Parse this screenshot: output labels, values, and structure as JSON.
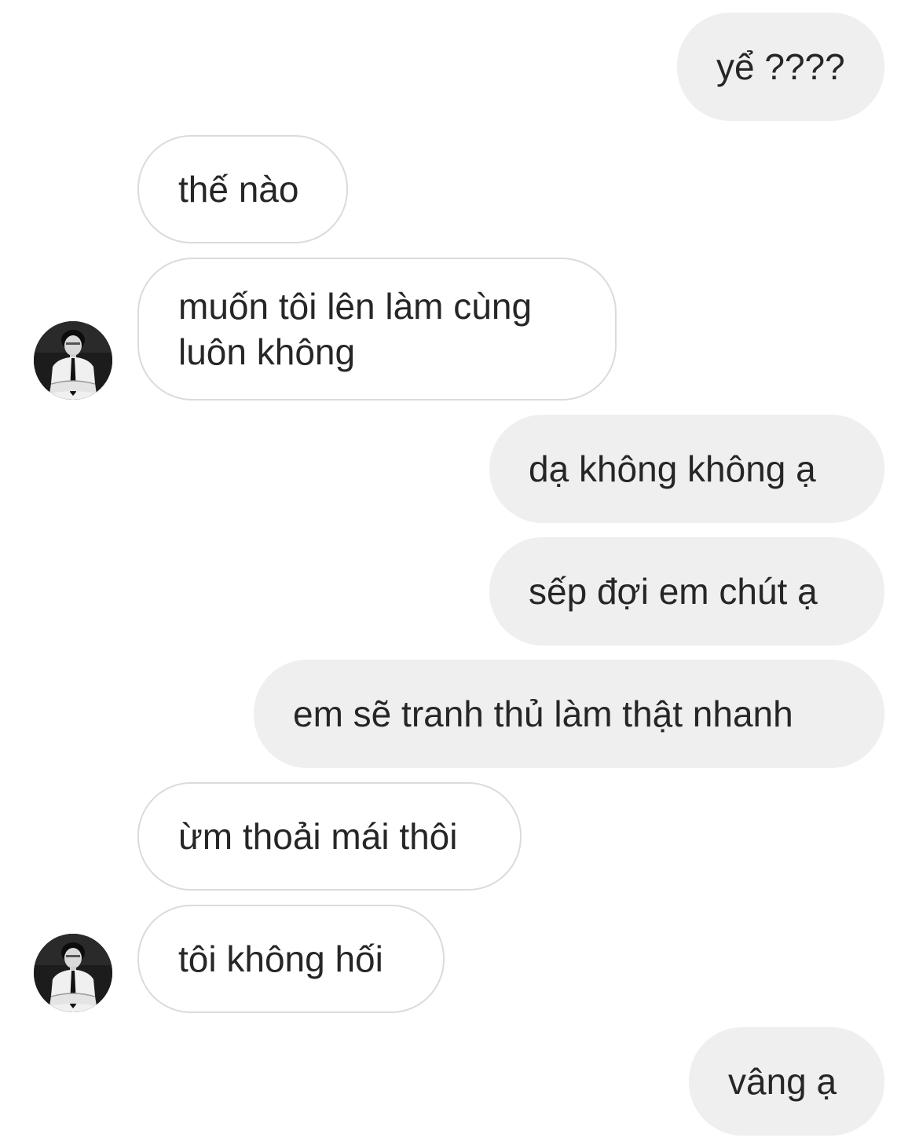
{
  "conversation": {
    "messages": [
      {
        "sender": "me",
        "text": "yể ????"
      },
      {
        "sender": "other",
        "text": "thế nào"
      },
      {
        "sender": "other",
        "text": "muốn tôi lên làm cùng luôn không",
        "avatar": "profile-photo"
      },
      {
        "sender": "me",
        "text": "dạ không không ạ"
      },
      {
        "sender": "me",
        "text": "sếp đợi em chút ạ"
      },
      {
        "sender": "me",
        "text": "em sẽ tranh thủ làm thật nhanh"
      },
      {
        "sender": "other",
        "text": "ừm thoải mái thôi"
      },
      {
        "sender": "other",
        "text": "tôi không hối",
        "avatar": "profile-photo"
      },
      {
        "sender": "me",
        "text": "vâng ạ"
      }
    ]
  },
  "colors": {
    "outgoing_bubble": "#efefef",
    "incoming_bubble": "#ffffff",
    "incoming_border": "#dbdbdb",
    "text": "#262626"
  }
}
